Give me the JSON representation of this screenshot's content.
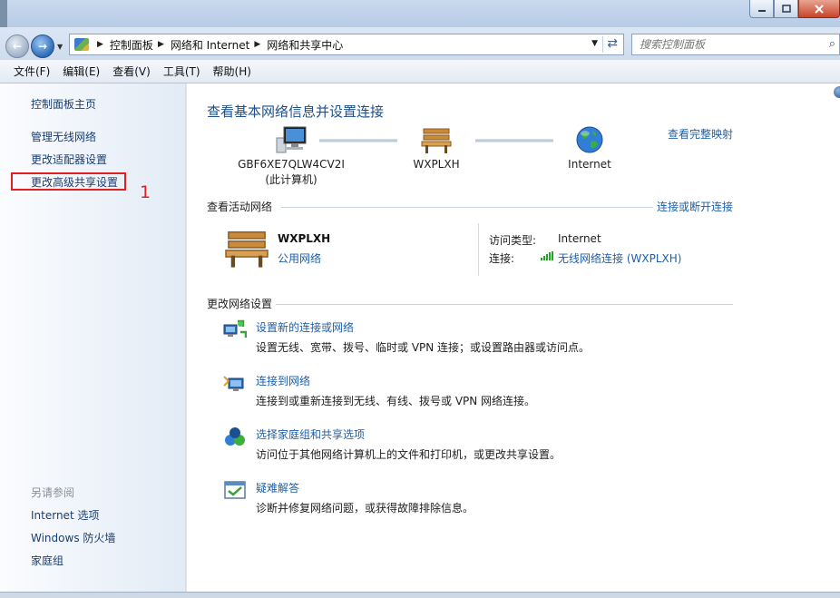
{
  "address": {
    "crumbs": [
      "控制面板",
      "网络和 Internet",
      "网络和共享中心"
    ],
    "search_placeholder": "搜索控制面板"
  },
  "menu": [
    "文件(F)",
    "编辑(E)",
    "查看(V)",
    "工具(T)",
    "帮助(H)"
  ],
  "sidebar": {
    "home": "控制面板主页",
    "items": [
      "管理无线网络",
      "更改适配器设置",
      "更改高级共享设置"
    ],
    "annotation": "1",
    "see_also_title": "另请参阅",
    "see_also": [
      "Internet 选项",
      "Windows 防火墙",
      "家庭组"
    ]
  },
  "main": {
    "title": "查看基本网络信息并设置连接",
    "full_map": "查看完整映射",
    "map": {
      "computer_name": "GBF6XE7QLW4CV2I",
      "computer_note": "(此计算机)",
      "network_name": "WXPLXH",
      "internet": "Internet"
    },
    "active": {
      "heading": "查看活动网络",
      "connect_link": "连接或断开连接",
      "name": "WXPLXH",
      "type": "公用网络",
      "access_label": "访问类型:",
      "access_value": "Internet",
      "conn_label": "连接:",
      "conn_value": "无线网络连接 (WXPLXH)"
    },
    "change": {
      "heading": "更改网络设置",
      "tasks": [
        {
          "title": "设置新的连接或网络",
          "desc": "设置无线、宽带、拨号、临时或 VPN 连接；或设置路由器或访问点。"
        },
        {
          "title": "连接到网络",
          "desc": "连接到或重新连接到无线、有线、拨号或 VPN 网络连接。"
        },
        {
          "title": "选择家庭组和共享选项",
          "desc": "访问位于其他网络计算机上的文件和打印机，或更改共享设置。"
        },
        {
          "title": "疑难解答",
          "desc": "诊断并修复网络问题，或获得故障排除信息。"
        }
      ]
    }
  },
  "colors": {
    "link": "#1f5faa",
    "title": "#1e4f8a",
    "annotation": "#e02020"
  }
}
